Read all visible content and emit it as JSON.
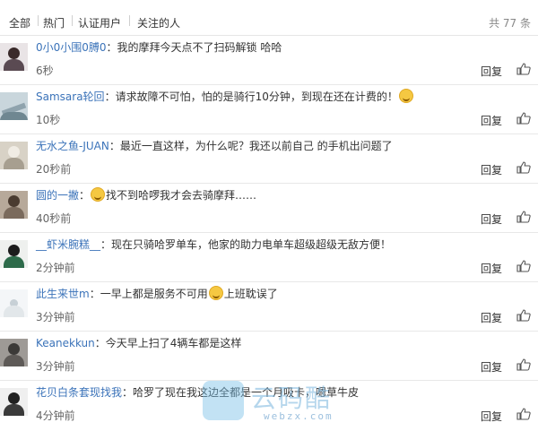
{
  "tabs": [
    {
      "label": "全部"
    },
    {
      "label": "热门"
    },
    {
      "label": "认证用户"
    },
    {
      "label": "关注的人"
    }
  ],
  "total_count": "共 77 条",
  "comments": [
    {
      "user": "0小0小围0膊0",
      "text": "：我的摩拜今天点不了扫码解锁 哈哈",
      "time": "6秒",
      "reply": "回复"
    },
    {
      "user": "Samsara轮回",
      "text": "：请求故障不可怕，怕的是骑行10分钟，到现在还在计费的！",
      "time": "10秒",
      "reply": "回复",
      "emoji_after": "laugh-emoji"
    },
    {
      "user": "无水之鱼-JUAN",
      "text": "：最近一直这样，为什么呢？我还以前自己 的手机出问题了",
      "time": "20秒前",
      "reply": "回复"
    },
    {
      "user": "圆的一撇",
      "text": "找不到哈啰我才会去骑摩拜……",
      "time": "40秒前",
      "reply": "回复",
      "emoji_before": "grin-emoji"
    },
    {
      "user": "__虾米腕糕__",
      "text": "：现在只骑哈罗单车，他家的助力电单车超级超级无敌方便！",
      "time": "2分钟前",
      "reply": "回复"
    },
    {
      "user": "此生来世m",
      "text": "：一早上都是服务不可用",
      "text2": "上班耽误了",
      "time": "3分钟前",
      "reply": "回复",
      "emoji_mid": "awkward-emoji"
    },
    {
      "user": "Keanekkun",
      "text": "：今天早上扫了4辆车都是这样",
      "time": "3分钟前",
      "reply": "回复"
    },
    {
      "user": "花贝白条套现找我",
      "text": "：哈罗了现在我这边全都是一个月吸卡，嗯草牛皮",
      "time": "4分钟前",
      "reply": "回复"
    }
  ],
  "watermark": {
    "text": "云码酷",
    "url": "webzx.com"
  },
  "colors": {
    "username": "#3b73b9",
    "divider": "#e8e8e8",
    "muted": "#888888"
  }
}
